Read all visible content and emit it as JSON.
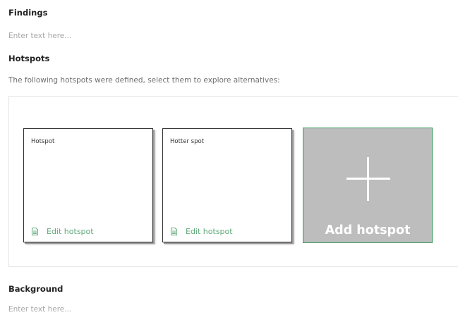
{
  "findings": {
    "title": "Findings",
    "placeholder": "Enter text here..."
  },
  "hotspots": {
    "title": "Hotspots",
    "description": "The following hotspots were defined, select them to explore alternatives:",
    "cards": [
      {
        "name": "Hotspot",
        "edit_label": "Edit hotspot",
        "icon": "document-icon"
      },
      {
        "name": "Hotter spot",
        "edit_label": "Edit hotspot",
        "icon": "document-icon"
      }
    ],
    "add_card": {
      "label": "Add hotspot",
      "icon": "plus-icon"
    }
  },
  "background": {
    "title": "Background",
    "placeholder": "Enter text here..."
  },
  "colors": {
    "accent_green": "#5fa97a",
    "add_card_bg": "#bdbdbd",
    "add_card_border": "#3f9a63"
  }
}
